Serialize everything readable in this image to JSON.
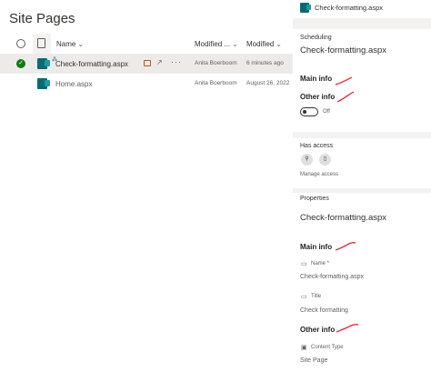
{
  "library": {
    "title": "Site Pages",
    "columns": {
      "name": "Name",
      "modified_by": "Modified ...",
      "modified": "Modified"
    },
    "rows": [
      {
        "name": "Check-formatting.aspx",
        "modified_by": "Anita Boerboom",
        "modified": "6 minutes ago",
        "selected": true
      },
      {
        "name": "Home.aspx",
        "modified_by": "Anita Boerboom",
        "modified": "August 26, 2022",
        "selected": false
      }
    ],
    "more_glyph": "···"
  },
  "panel": {
    "file_name": "Check-formatting.aspx",
    "scheduling": {
      "heading": "Scheduling",
      "file_name": "Check-formatting.aspx",
      "main_info": "Main info",
      "other_info": "Other info",
      "toggle_label": "Off"
    },
    "access": {
      "heading": "Has access",
      "manage": "Manage access"
    },
    "properties": {
      "heading": "Properties",
      "file_name": "Check-formatting.aspx",
      "main_info": "Main info",
      "name_label": "Name *",
      "name_value": "Check-formatting.aspx",
      "title_label": "Title",
      "title_value": "Check formatting",
      "other_info": "Other info",
      "content_type_label": "Content Type",
      "content_type_value": "Site Page"
    }
  },
  "colors": {
    "accent": "#036c70",
    "check": "#107c10",
    "annotation": "#e81123"
  }
}
